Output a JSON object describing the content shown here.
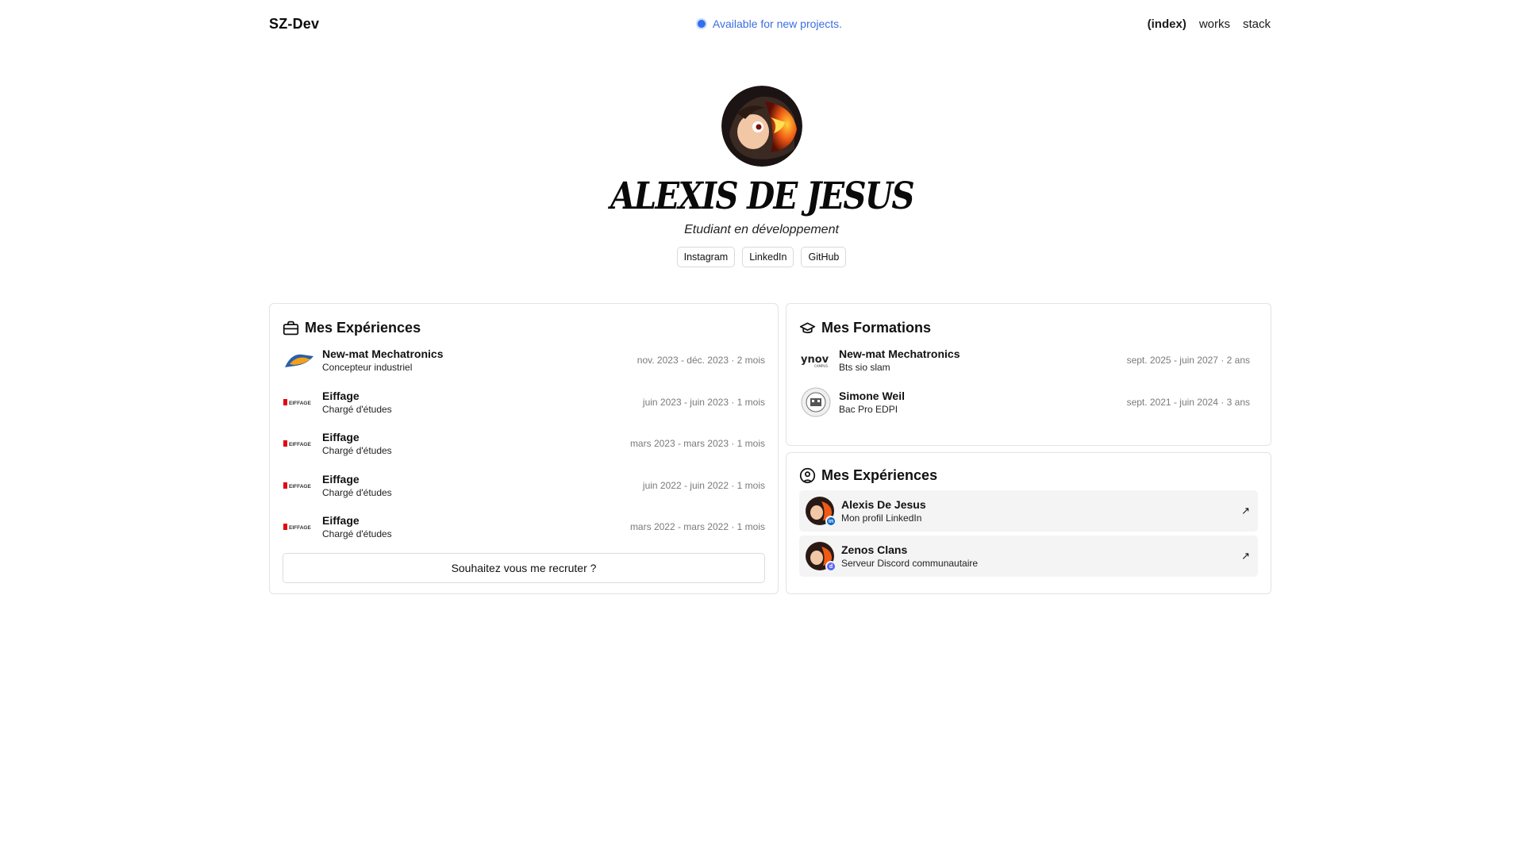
{
  "header": {
    "brand": "SZ-Dev",
    "availability": "Available for new projects.",
    "nav": [
      "(index)",
      "works",
      "stack"
    ]
  },
  "hero": {
    "name": "ALEXIS DE JESUS",
    "subtitle": "Etudiant en développement",
    "socials": [
      "Instagram",
      "LinkedIn",
      "GitHub"
    ]
  },
  "experiences": {
    "title": "Mes Expériences",
    "items": [
      {
        "company": "New-mat Mechatronics",
        "role": "Concepteur industriel",
        "dates": "nov. 2023 - déc. 2023 · 2 mois",
        "logo": "newmat-logo"
      },
      {
        "company": "Eiffage",
        "role": "Chargé d'études",
        "dates": "juin 2023 - juin 2023 · 1 mois",
        "logo": "eiffage-logo"
      },
      {
        "company": "Eiffage",
        "role": "Chargé d'études",
        "dates": "mars 2023 - mars 2023 · 1 mois",
        "logo": "eiffage-logo"
      },
      {
        "company": "Eiffage",
        "role": "Chargé d'études",
        "dates": "juin 2022 - juin 2022 · 1 mois",
        "logo": "eiffage-logo"
      },
      {
        "company": "Eiffage",
        "role": "Chargé d'études",
        "dates": "mars 2022 - mars 2022 · 1 mois",
        "logo": "eiffage-logo"
      }
    ],
    "cta": "Souhaitez vous me recruter ?"
  },
  "formations": {
    "title": "Mes Formations",
    "items": [
      {
        "school": "New-mat Mechatronics",
        "degree": "Bts sio slam",
        "dates": "sept. 2025 - juin 2027 · 2 ans",
        "logo": "ynov-logo"
      },
      {
        "school": "Simone Weil",
        "degree": "Bac Pro EDPI",
        "dates": "sept. 2021 - juin 2024 · 3 ans",
        "logo": "simone-weil-logo"
      }
    ]
  },
  "links": {
    "title": "Mes Expériences",
    "items": [
      {
        "name": "Alexis De Jesus",
        "desc": "Mon profil LinkedIn",
        "badge": "in",
        "badge_color": "#0a66c2"
      },
      {
        "name": "Zenos Clans",
        "desc": "Serveur Discord communautaire",
        "badge": "d",
        "badge_color": "#5865f2"
      }
    ]
  },
  "colors": {
    "accent": "#3b6fe0",
    "eiffage_red": "#e30613"
  }
}
